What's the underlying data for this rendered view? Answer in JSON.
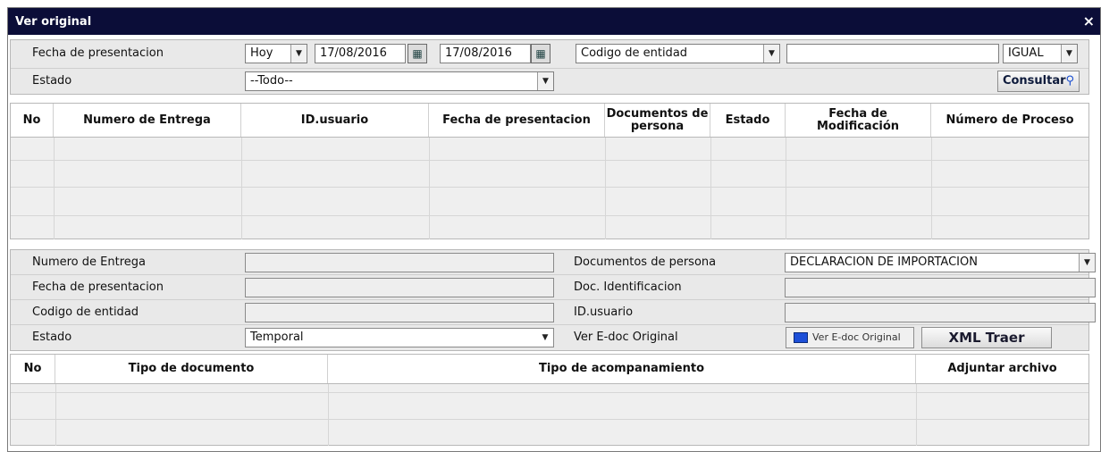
{
  "window": {
    "title": "Ver original",
    "close_icon": "×"
  },
  "search": {
    "fecha_label": "Fecha de presentacion",
    "period_value": "Hoy",
    "date_from": "17/08/2016",
    "date_to": "17/08/2016",
    "field_select": "Codigo de entidad",
    "search_text": "",
    "operator": "IGUAL",
    "estado_label": "Estado",
    "estado_value": "--Todo--",
    "consultar_label": "Consultar"
  },
  "results": {
    "columns": [
      "No",
      "Numero de Entrega",
      "ID.usuario",
      "Fecha de presentacion",
      "Documentos de persona",
      "Estado",
      "Fecha de Modificación",
      "Número de Proceso"
    ],
    "rows": []
  },
  "detail": {
    "numero_entrega_label": "Numero de Entrega",
    "numero_entrega_value": "",
    "fecha_label": "Fecha de presentacion",
    "fecha_value": "",
    "codigo_label": "Codigo de entidad",
    "codigo_value": "",
    "estado_label": "Estado",
    "estado_value": "Temporal",
    "docs_persona_label": "Documentos de persona",
    "docs_persona_value": "DECLARACION DE IMPORTACION",
    "doc_ident_label": "Doc. Identificacion",
    "doc_ident_value": "",
    "usuario_label": "ID.usuario",
    "usuario_value": "",
    "ver_edoc_label": "Ver E-doc Original",
    "ver_edoc_button": "Ver E-doc Original",
    "xml_button": "XML Traer"
  },
  "attachments": {
    "columns": [
      "No",
      "Tipo de documento",
      "Tipo de acompanamiento",
      "Adjuntar archivo"
    ],
    "rows": []
  }
}
